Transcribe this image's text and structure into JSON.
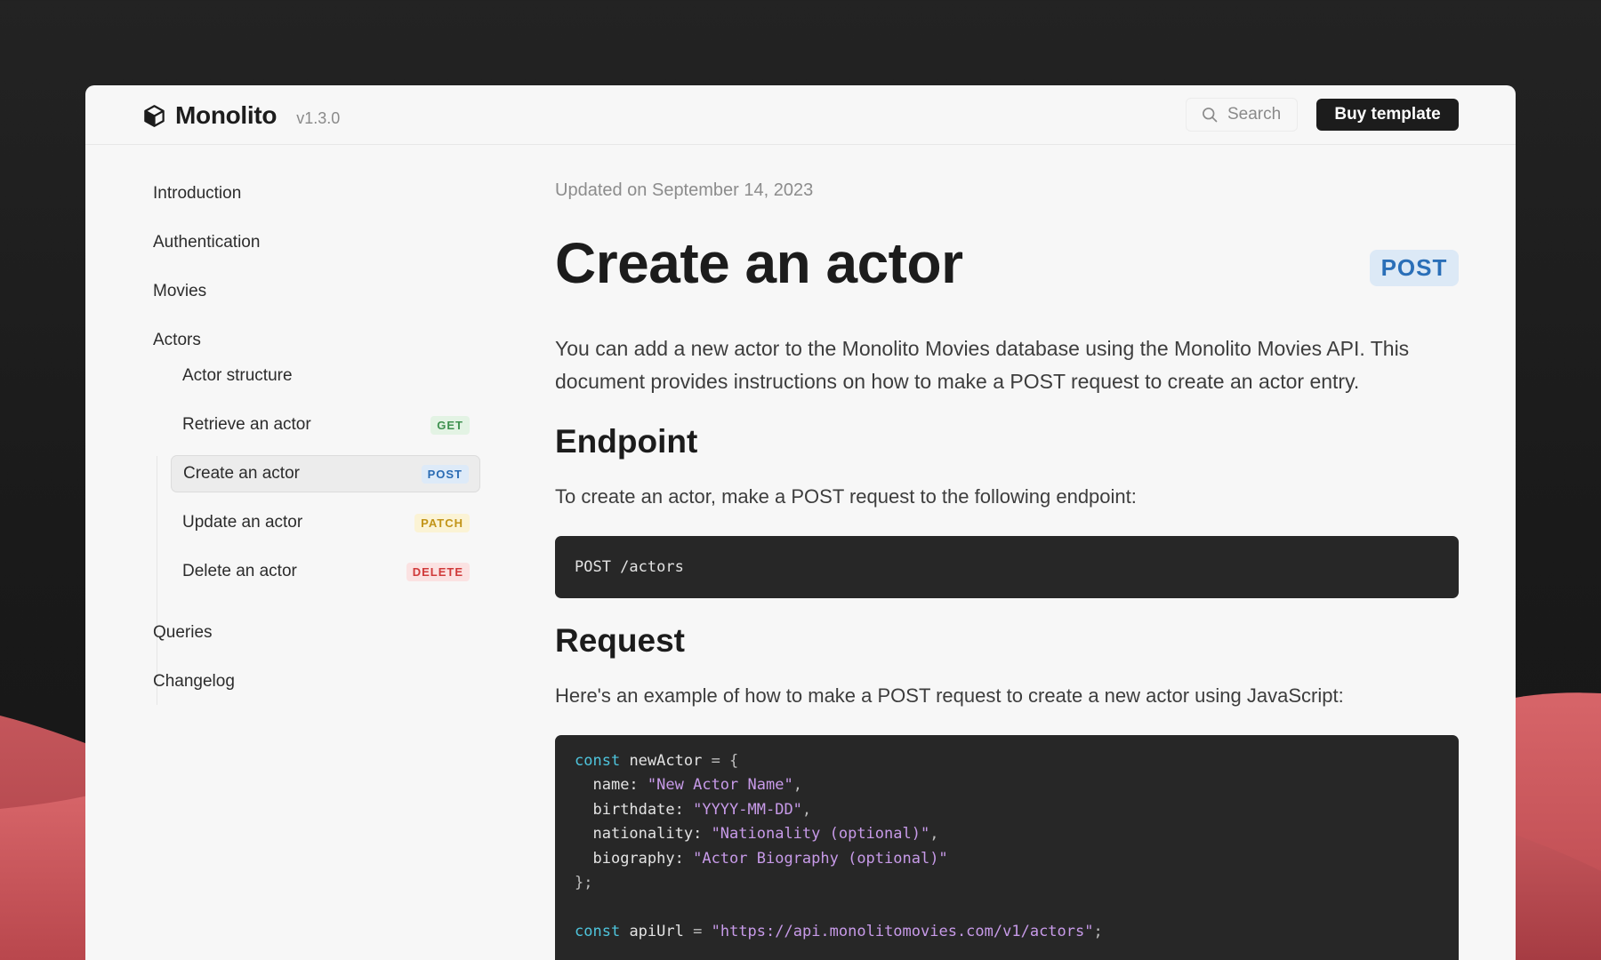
{
  "brand": {
    "name": "Monolito",
    "version": "v1.3.0"
  },
  "header": {
    "search_label": "Search",
    "buy_label": "Buy template"
  },
  "sidebar": {
    "items": [
      {
        "label": "Introduction"
      },
      {
        "label": "Authentication"
      },
      {
        "label": "Movies"
      },
      {
        "label": "Actors"
      },
      {
        "label": "Queries"
      },
      {
        "label": "Changelog"
      }
    ],
    "subitems": [
      {
        "label": "Actor structure",
        "badge": ""
      },
      {
        "label": "Retrieve an actor",
        "badge": "GET"
      },
      {
        "label": "Create an actor",
        "badge": "POST",
        "active": true
      },
      {
        "label": "Update an actor",
        "badge": "PATCH"
      },
      {
        "label": "Delete an actor",
        "badge": "DELETE"
      }
    ]
  },
  "main": {
    "updated": "Updated on September 14, 2023",
    "title": "Create an actor",
    "method": "POST",
    "intro": "You can add a new actor to the Monolito Movies database using the Monolito Movies API. This document provides instructions on how to make a POST request to create an actor entry.",
    "endpoint_heading": "Endpoint",
    "endpoint_text": "To create an actor, make a POST request to the following endpoint:",
    "endpoint_code": "POST /actors",
    "request_heading": "Request",
    "request_text": "Here's an example of how to make a POST request to create a new actor using JavaScript:",
    "code": {
      "kw_const": "const",
      "var_newActor": "newActor",
      "open": "= {",
      "name_key": "name:",
      "name_val": "\"New Actor Name\"",
      "birthdate_key": "birthdate:",
      "birthdate_val": "\"YYYY-MM-DD\"",
      "nationality_key": "nationality:",
      "nationality_val": "\"Nationality (optional)\"",
      "biography_key": "biography:",
      "biography_val": "\"Actor Biography (optional)\"",
      "close": "};",
      "var_apiUrl": "apiUrl",
      "eq": "=",
      "url_val": "\"https://api.monolitomovies.com/v1/actors\"",
      "semi": ";",
      "comma": ","
    }
  },
  "colors": {
    "accent_blue": "#2a6fb8",
    "get": "#3f9150",
    "patch": "#c29418",
    "delete": "#d03a3a",
    "hill": "#c95a5e"
  }
}
